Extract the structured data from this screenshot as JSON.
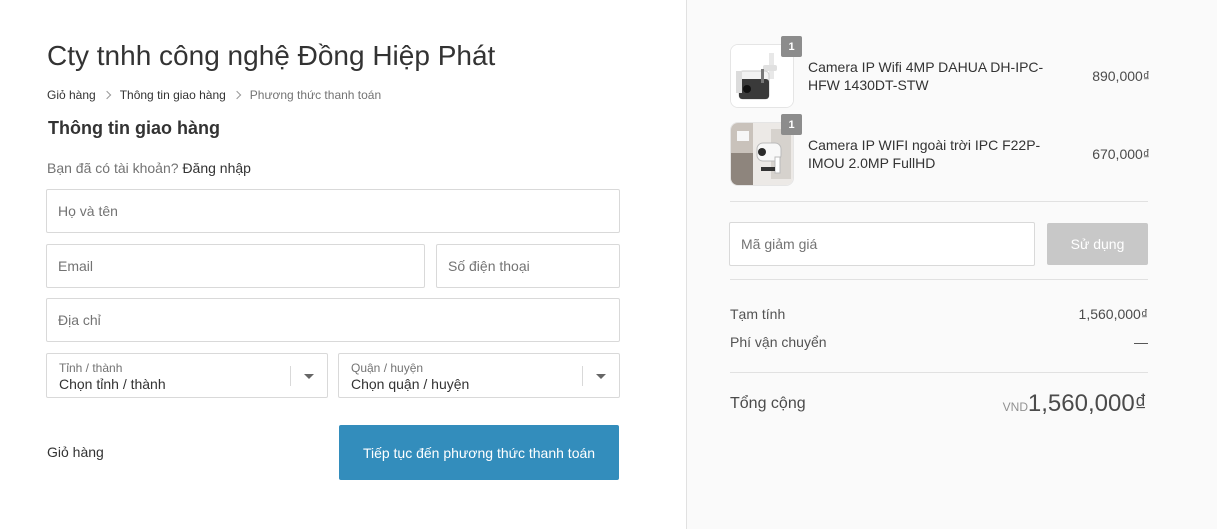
{
  "shop": {
    "title": "Cty tnhh công nghệ Đồng Hiệp Phát"
  },
  "breadcrumb": {
    "cart": "Giỏ hàng",
    "shipping": "Thông tin giao hàng",
    "payment": "Phương thức thanh toán"
  },
  "section_title": "Thông tin giao hàng",
  "login_prompt": {
    "question": "Bạn đã có tài khoản?",
    "link": "Đăng nhập"
  },
  "form": {
    "fullname_placeholder": "Họ và tên",
    "email_placeholder": "Email",
    "phone_placeholder": "Số điện thoại",
    "address_placeholder": "Địa chỉ",
    "province": {
      "label": "Tỉnh / thành",
      "value": "Chọn tỉnh / thành"
    },
    "district": {
      "label": "Quận / huyện",
      "value": "Chọn quận / huyện"
    }
  },
  "actions": {
    "back": "Giỏ hàng",
    "continue": "Tiếp tục đến phương thức thanh toán"
  },
  "cart": {
    "items": [
      {
        "quantity": "1",
        "name": "Camera IP Wifi 4MP DAHUA DH-IPC-HFW 1430DT-STW",
        "price": "890,000₫"
      },
      {
        "quantity": "1",
        "name": "Camera IP WIFI ngoài trời IPC F22P-IMOU 2.0MP FullHD",
        "price": "670,000₫"
      }
    ],
    "discount_placeholder": "Mã giảm giá",
    "apply_label": "Sử dụng",
    "subtotal_label": "Tạm tính",
    "subtotal_value": "1,560,000₫",
    "shipping_label": "Phí vận chuyển",
    "shipping_value": "—",
    "total_label": "Tổng cộng",
    "total_currency": "VND",
    "total_value": "1,560,000₫"
  },
  "colors": {
    "primary_button": "#338dbc",
    "disabled_button": "#c8c8c8",
    "qty_badge": "#8c8c8c"
  }
}
